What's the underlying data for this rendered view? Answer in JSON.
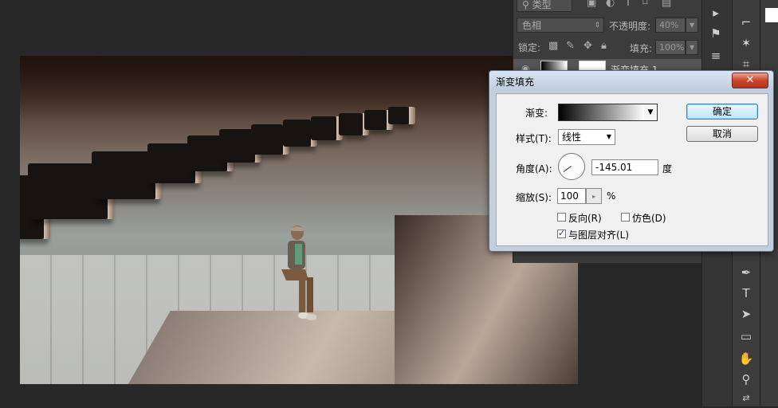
{
  "layers_panel": {
    "filter_type": "类型",
    "blend_mode": "色相",
    "opacity_label": "不透明度:",
    "opacity_value": "40%",
    "lock_label": "锁定:",
    "fill_label": "填充:",
    "fill_value": "100%",
    "layer_name": "渐变填充 1"
  },
  "dialog": {
    "title": "渐变填充",
    "close_symbol": "✕",
    "gradient_label": "渐变:",
    "style_label": "样式(T):",
    "style_value": "线性",
    "angle_label": "角度(A):",
    "angle_value": "-145.01",
    "angle_unit": "度",
    "scale_label": "缩放(S):",
    "scale_value": "100",
    "scale_unit": "%",
    "reverse_label": "反向(R)",
    "reverse_checked": false,
    "dither_label": "仿色(D)",
    "dither_checked": false,
    "align_label": "与图层对齐(L)",
    "align_checked": true,
    "ok_label": "确定",
    "cancel_label": "取消"
  },
  "tools": [
    {
      "name": "polygonal-lasso-icon",
      "glyph": "⌐"
    },
    {
      "name": "magic-wand-icon",
      "glyph": "✶"
    },
    {
      "name": "crop-icon",
      "glyph": "⌗"
    },
    {
      "name": "pen-icon",
      "glyph": "✒"
    },
    {
      "name": "type-icon",
      "glyph": "T"
    },
    {
      "name": "path-select-icon",
      "glyph": "➤"
    },
    {
      "name": "rectangle-icon",
      "glyph": "▭"
    },
    {
      "name": "hand-icon",
      "glyph": "✋"
    },
    {
      "name": "zoom-icon",
      "glyph": "⚲"
    }
  ]
}
